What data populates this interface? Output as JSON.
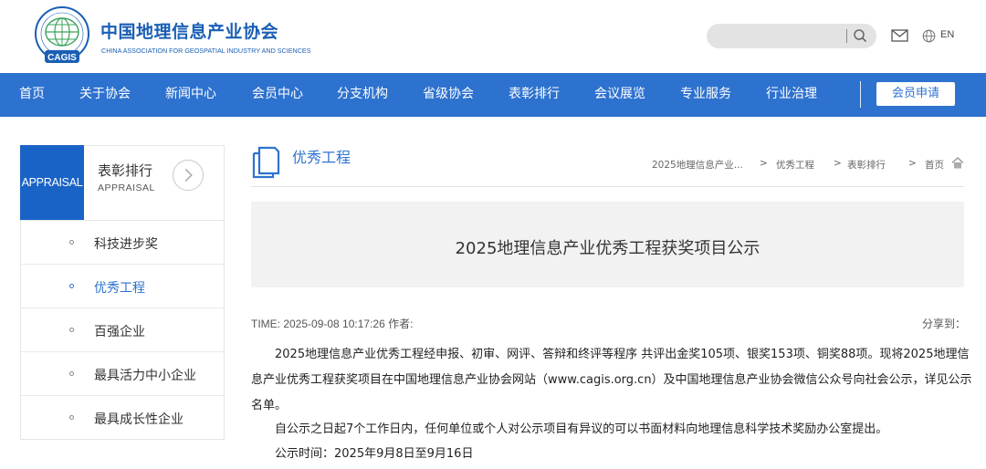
{
  "header": {
    "org_name_cn": "中国地理信息产业协会",
    "org_name_en": "CHINA ASSOCIATION FOR GEOSPATIAL INDUSTRY AND SCIENCES",
    "logo_text": "CAGIS",
    "lang": "EN",
    "brand_color": "#1a5fb4"
  },
  "nav": {
    "items": [
      "首页",
      "关于协会",
      "新闻中心",
      "会员中心",
      "分支机构",
      "省级协会",
      "表彰排行",
      "会议展览",
      "专业服务",
      "行业治理"
    ],
    "apply_label": "会员申请",
    "bg_color": "#2e72cf"
  },
  "sidebar": {
    "badge": "APPRAISAL",
    "title": "表彰排行",
    "subtitle": "APPRAISAL",
    "items": [
      {
        "label": "科技进步奖"
      },
      {
        "label": "优秀工程",
        "active": true
      },
      {
        "label": "百强企业"
      },
      {
        "label": "最具活力中小企业"
      },
      {
        "label": "最具成长性企业"
      }
    ]
  },
  "content": {
    "section_title": "优秀工程",
    "breadcrumb": [
      "2025地理信息产业...",
      ">",
      "优秀工程",
      ">",
      "表彰排行",
      ">",
      "首页"
    ],
    "article_title": "2025地理信息产业优秀工程获奖项目公示",
    "meta": "TIME: 2025-09-08 10:17:26 作者:",
    "share": "分享到：",
    "paragraphs": [
      "2025地理信息产业优秀工程经申报、初审、网评、答辩和终评等程序 共评出金奖105项、银奖153项、铜奖88项。现将2025地理信息产业优秀工程获奖项目在中国地理信息产业协会网站（www.cagis.org.cn）及中国地理信息产业协会微信公众号向社会公示，详见公示名单。",
      "自公示之日起7个工作日内，任何单位或个人对公示项目有异议的可以书面材料向地理信息科学技术奖励办公室提出。",
      "公示时间：2025年9月8日至9月16日"
    ]
  }
}
